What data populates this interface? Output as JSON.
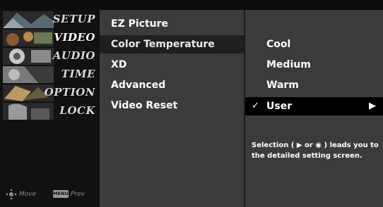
{
  "categories": [
    {
      "label": "SETUP",
      "icon": "setup-thumbnail-icon"
    },
    {
      "label": "VIDEO",
      "icon": "video-thumbnail-icon"
    },
    {
      "label": "AUDIO",
      "icon": "audio-thumbnail-icon"
    },
    {
      "label": "TIME",
      "icon": "time-thumbnail-icon"
    },
    {
      "label": "OPTION",
      "icon": "option-thumbnail-icon"
    },
    {
      "label": "LOCK",
      "icon": "lock-thumbnail-icon"
    }
  ],
  "active_category": "VIDEO",
  "footer": {
    "move_label": "Move",
    "menu_key": "MENU",
    "prev_label": "Prev"
  },
  "submenu": {
    "items": [
      "EZ Picture",
      "Color Temperature",
      "XD",
      "Advanced",
      "Video Reset"
    ],
    "selected": "Color Temperature"
  },
  "options": {
    "items": [
      "Cool",
      "Medium",
      "Warm",
      "User"
    ],
    "selected": "User",
    "check_mark": "✓",
    "arrow": "▶"
  },
  "help": {
    "text": "Selection ( ▶ or ◉ ) leads you to the detailed setting screen."
  },
  "colors": {
    "panel": "#3b3b3b",
    "selected_mid": "#1f1f1f",
    "selected_option": "#000000",
    "text": "#ffffff"
  }
}
